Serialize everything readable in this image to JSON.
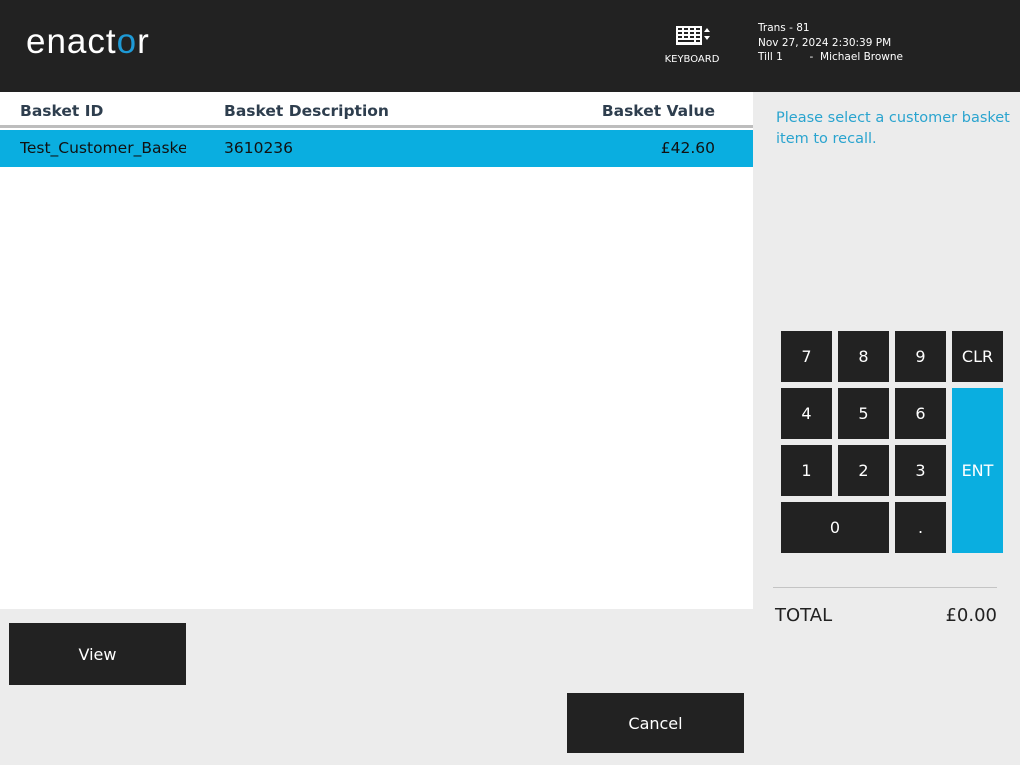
{
  "header": {
    "logo_text_main": "enact",
    "logo_text_o": "o",
    "logo_text_end": "r",
    "keyboard_label": "KEYBOARD",
    "trans": "Trans - 81",
    "datetime": "Nov 27, 2024 2:30:39 PM",
    "till_user": "Till 1        -  Michael Browne"
  },
  "table": {
    "columns": [
      "Basket ID",
      "Basket Description",
      "Basket Value"
    ],
    "rows": [
      {
        "id": "Test_Customer_Basket",
        "description": "3610236",
        "value": "£42.60",
        "selected": true
      }
    ]
  },
  "side": {
    "prompt": "Please select a customer basket item to recall."
  },
  "keypad": {
    "k7": "7",
    "k8": "8",
    "k9": "9",
    "clr": "CLR",
    "k4": "4",
    "k5": "5",
    "k6": "6",
    "ent": "ENT",
    "k1": "1",
    "k2": "2",
    "k3": "3",
    "k0": "0",
    "dot": "."
  },
  "total": {
    "label": "TOTAL",
    "value": "£0.00"
  },
  "buttons": {
    "view": "View",
    "cancel": "Cancel"
  },
  "colors": {
    "header_bg": "#222222",
    "accent": "#0aaee0",
    "prompt_text": "#2aa4cf",
    "logo_accent": "#1e9ad6"
  }
}
